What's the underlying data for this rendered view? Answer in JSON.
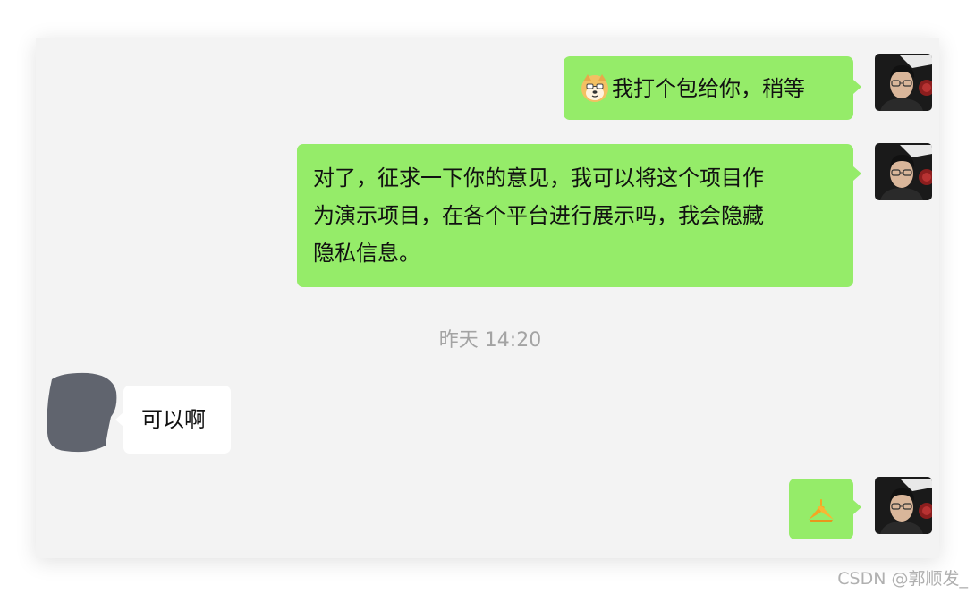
{
  "messages": [
    {
      "sender": "me",
      "emoji": "doge-emoji",
      "text": "我打个包给你，稍等"
    },
    {
      "sender": "me",
      "text": "对了，征求一下你的意见，我可以将这个项目作为演示项目，在各个平台进行展示吗，我会隐藏隐私信息。",
      "lines": [
        "对了，征求一下你的意见，我可以将这个项目作",
        "为演示项目，在各个平台进行展示吗，我会隐藏",
        "隐私信息。"
      ]
    },
    {
      "type": "timestamp",
      "text": "昨天 14:20"
    },
    {
      "sender": "other",
      "text": "可以啊"
    },
    {
      "sender": "me",
      "emoji": "handshake-emoji",
      "text": "🙏"
    }
  ],
  "watermark": "CSDN @郭顺发_",
  "colors": {
    "my_bubble": "#95ec69",
    "their_bubble": "#ffffff",
    "background": "#f3f3f3",
    "timestamp": "#a3a3a3"
  }
}
